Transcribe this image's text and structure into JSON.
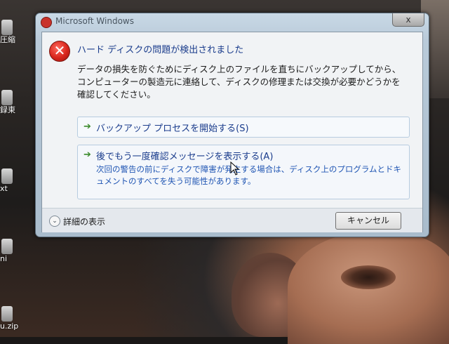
{
  "desktop": {
    "icons": [
      {
        "label": "圧縮"
      },
      {
        "label": "録東"
      },
      {
        "label": "xt"
      },
      {
        "label": "ni"
      },
      {
        "label": "u.zip"
      }
    ]
  },
  "window": {
    "title": "Microsoft Windows",
    "close_glyph": "x",
    "main_instruction": "ハード ディスクの問題が検出されました",
    "content": "データの損失を防ぐためにディスク上のファイルを直ちにバックアップしてから、コンピューターの製造元に連絡して、ディスクの修理または交換が必要かどうかを確認してください。",
    "commands": [
      {
        "arrow": "➔",
        "title": "バックアップ プロセスを開始する(S)"
      },
      {
        "arrow": "➔",
        "title": "後でもう一度確認メッセージを表示する(A)",
        "description": "次回の警告の前にディスクで障害が発生する場合は、ディスク上のプログラムとドキュメントのすべてを失う可能性があります。"
      }
    ],
    "details_label": "詳細の表示",
    "details_glyph": "⌄",
    "cancel_label": "キャンセル",
    "error_glyph": "✕"
  }
}
